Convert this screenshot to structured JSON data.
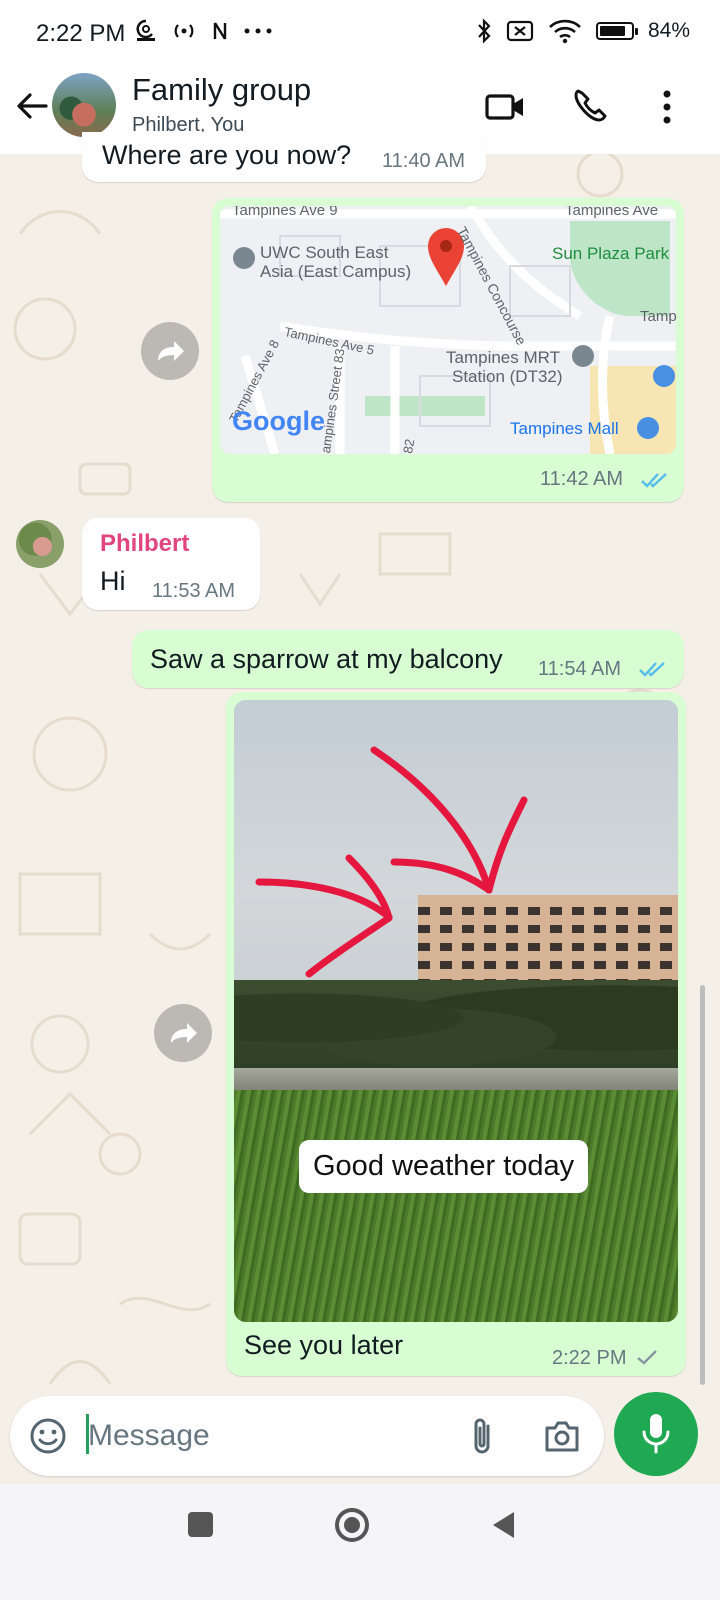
{
  "status_bar": {
    "time": "2:22 PM",
    "battery_percent": "84%",
    "battery_level": 0.84,
    "left_icons": [
      "threads-icon",
      "hotspot-icon",
      "nfc-icon",
      "more-dots-icon"
    ],
    "right_icons": [
      "bluetooth-icon",
      "no-sim-icon",
      "wifi-icon",
      "battery-icon"
    ]
  },
  "header": {
    "title": "Family group",
    "subtitle": "Philbert, You",
    "icons": [
      "back-arrow-icon",
      "video-call-icon",
      "voice-call-icon",
      "overflow-menu-icon"
    ]
  },
  "messages": {
    "m1": {
      "text": "Where are you now?",
      "time": "11:40 AM"
    },
    "m2": {
      "time": "11:42 AM",
      "map_labels": {
        "street_top_left": "Tampines Ave 9",
        "street_top_right": "Tampines Ave",
        "uwc": "UWC South East",
        "uwc2": "Asia (East Campus)",
        "concourse": "Tampines Concourse",
        "park": "Sun Plaza Park",
        "tamp": "Tamp",
        "ave5": "Tampines Ave 5",
        "mrt1": "Tampines MRT",
        "mrt2": "Station (DT32)",
        "ave8": "Tampines Ave 8",
        "street83": "ampines Street 83",
        "num82": "82",
        "mall": "Tampines Mall",
        "google": "Google"
      }
    },
    "m3": {
      "sender": "Philbert",
      "text": "Hi",
      "time": "11:53 AM"
    },
    "m4": {
      "text": "Saw a sparrow at my balcony",
      "time": "11:54 AM"
    },
    "m5": {
      "image_caption_overlay": "Good weather today",
      "text": "See you later",
      "time": "2:22 PM"
    }
  },
  "input": {
    "placeholder": "Message"
  },
  "colors": {
    "outgoing": "#d9fdd3",
    "incoming": "#ffffff",
    "sender_name": "#e0457b",
    "read_ticks": "#53bdeb",
    "mic": "#1ea952",
    "chat_bg": "#f4efe7"
  },
  "nav_icons": [
    "recents-square-icon",
    "home-circle-icon",
    "back-triangle-icon"
  ]
}
